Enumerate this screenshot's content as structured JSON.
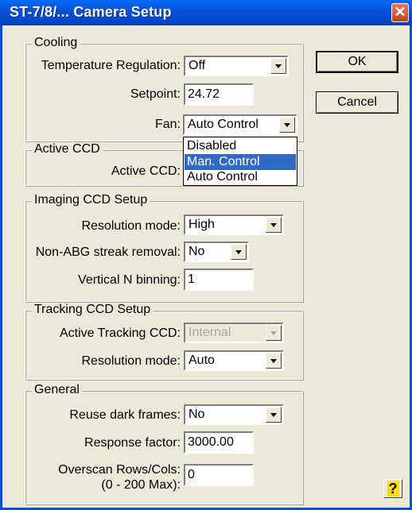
{
  "window": {
    "title": "ST-7/8/... Camera Setup"
  },
  "buttons": {
    "ok": "OK",
    "cancel": "Cancel",
    "close": "✕",
    "help": "?"
  },
  "cooling": {
    "legend": "Cooling",
    "temp_label": "Temperature Regulation:",
    "temp_value": "Off",
    "setpoint_label": "Setpoint:",
    "setpoint_value": "24.72",
    "fan_label": "Fan:",
    "fan_value": "Auto Control",
    "fan_options": [
      "Disabled",
      "Man. Control",
      "Auto Control"
    ],
    "fan_highlighted": "Man. Control"
  },
  "active_ccd": {
    "legend": "Active CCD",
    "label": "Active CCD:"
  },
  "imaging": {
    "legend": "Imaging CCD Setup",
    "res_label": "Resolution mode:",
    "res_value": "High",
    "streak_label": "Non-ABG streak removal:",
    "streak_value": "No",
    "vbin_label": "Vertical N binning:",
    "vbin_value": "1"
  },
  "tracking": {
    "legend": "Tracking CCD Setup",
    "active_label": "Active Tracking CCD:",
    "active_value": "Internal",
    "res_label": "Resolution mode:",
    "res_value": "Auto"
  },
  "general": {
    "legend": "General",
    "reuse_label": "Reuse dark frames:",
    "reuse_value": "No",
    "response_label": "Response factor:",
    "response_value": "3000.00",
    "overscan_label_1": "Overscan Rows/Cols:",
    "overscan_label_2": "(0 - 200 Max):",
    "overscan_value": "0"
  }
}
